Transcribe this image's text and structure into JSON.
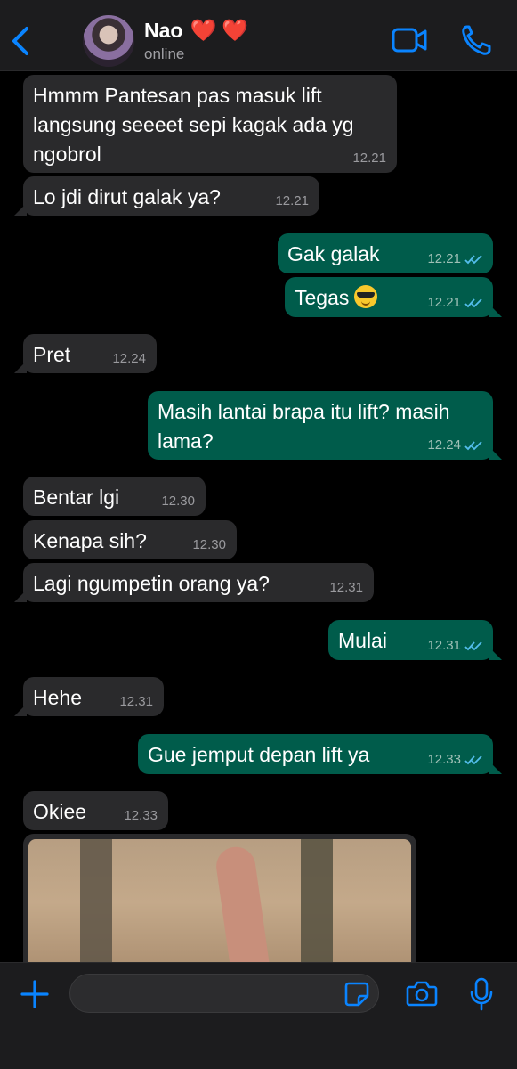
{
  "header": {
    "back_icon": "chevron-left-icon",
    "contact_name": "Nao",
    "name_emoji": "❤️❤️",
    "status": "online",
    "video_icon": "video-call-icon",
    "call_icon": "phone-icon",
    "accent_color": "#0a84ff"
  },
  "messages": [
    {
      "text": "Hmmm Pantesan pas masuk lift langsung seeeet sepi kagak ada yg ngobrol",
      "time": "12.21",
      "direction": "in"
    },
    {
      "text": "Lo jdi dirut galak ya?",
      "time": "12.21",
      "direction": "in"
    },
    {
      "text": "Gak galak",
      "time": "12.21",
      "direction": "out",
      "read": true
    },
    {
      "text": "Tegas",
      "emoji": "smiling-face-with-sunglasses",
      "time": "12.21",
      "direction": "out",
      "read": true
    },
    {
      "text": "Pret",
      "time": "12.24",
      "direction": "in"
    },
    {
      "text": "Masih lantai brapa itu lift? masih lama?",
      "time": "12.24",
      "direction": "out",
      "read": true
    },
    {
      "text": "Bentar lgi",
      "time": "12.30",
      "direction": "in"
    },
    {
      "text": "Kenapa sih?",
      "time": "12.30",
      "direction": "in"
    },
    {
      "text": "Lagi ngumpetin orang ya?",
      "time": "12.31",
      "direction": "in"
    },
    {
      "text": "Mulai",
      "time": "12.31",
      "direction": "out",
      "read": true
    },
    {
      "text": "Hehe",
      "time": "12.31",
      "direction": "in"
    },
    {
      "text": "Gue jemput depan lift ya",
      "time": "12.33",
      "direction": "out",
      "read": true
    },
    {
      "text": "Okiee",
      "time": "12.33",
      "direction": "in"
    }
  ],
  "image_message": {
    "direction": "in"
  },
  "composer": {
    "placeholder": "",
    "add_icon": "plus-icon",
    "sticker_icon": "sticker-icon",
    "camera_icon": "camera-icon",
    "mic_icon": "microphone-icon"
  },
  "colors": {
    "incoming_bubble": "#2a2a2c",
    "outgoing_bubble": "#005c4b",
    "read_ticks": "#53bdeb",
    "background": "#000000"
  }
}
